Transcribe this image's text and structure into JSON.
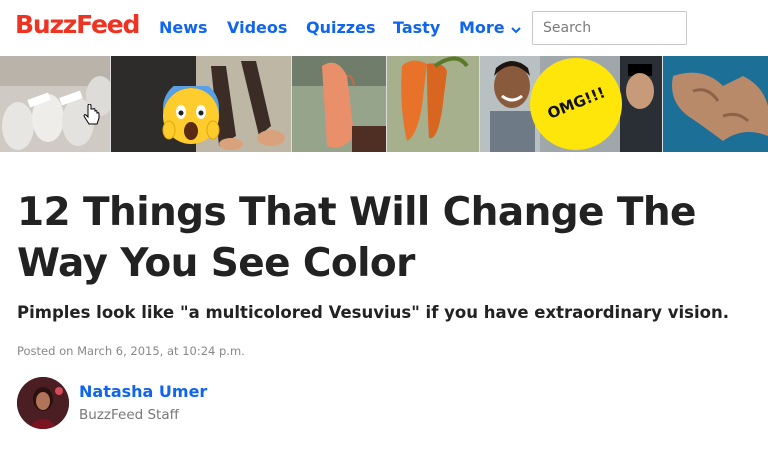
{
  "brand": {
    "logo_text": "BuzzFeed",
    "color": "#ee3322"
  },
  "nav": {
    "items": [
      {
        "label": "News"
      },
      {
        "label": "Videos"
      },
      {
        "label": "Quizzes"
      },
      {
        "label": "Tasty"
      },
      {
        "label": "More",
        "icon": "chevron-down-icon"
      }
    ],
    "link_color": "#0f65ef"
  },
  "search": {
    "placeholder": "Search",
    "value": ""
  },
  "image_strip": {
    "thumbnails": [
      {
        "description": "cups-labeled-items",
        "icon": "cursor-hand-icon"
      },
      {
        "description": "screaming-emoji-feet",
        "icon": "screaming-face-icon"
      },
      {
        "description": "carrot-hand"
      },
      {
        "description": "carrot-legs"
      },
      {
        "description": "man-smiling-omg",
        "badge_text": "OMG!!!"
      },
      {
        "description": "coastline-aerial"
      }
    ]
  },
  "article": {
    "title": "12 Things That Will Change The Way You See Color",
    "dek": "Pimples look like \"a multicolored Vesuvius\" if you have extraordinary vision.",
    "posted": "Posted on March 6, 2015, at 10:24 p.m."
  },
  "author": {
    "name": "Natasha Umer",
    "role": "BuzzFeed Staff"
  }
}
